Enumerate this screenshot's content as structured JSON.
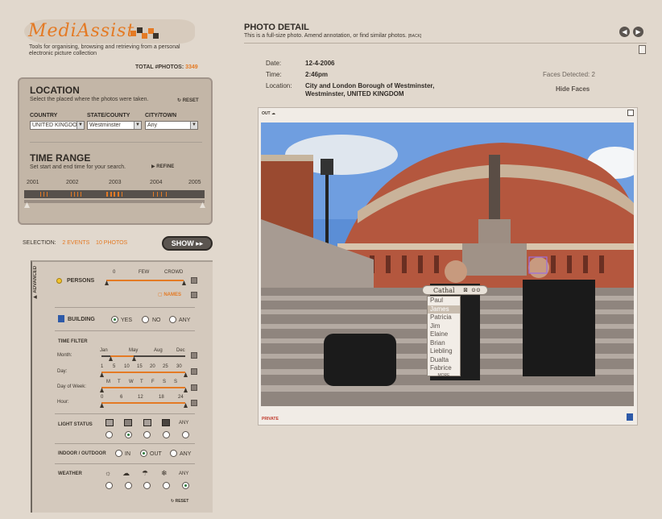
{
  "logo": {
    "text": "MediAssist",
    "tagline": "Tools for organising, browsing and retrieving from a personal electronic picture collection",
    "brand_color": "#e47a24"
  },
  "total": {
    "label": "TOTAL #PHOTOS:",
    "value": "3349"
  },
  "location": {
    "title": "LOCATION",
    "subtitle": "Select the placed where the photos were taken.",
    "reset_label": "RESET",
    "country_label": "COUNTRY",
    "country_value": "UNITED KINGDOM",
    "state_label": "STATE/COUNTY",
    "state_value": "Westminster",
    "city_label": "CITY/TOWN",
    "city_value": "Any"
  },
  "time_range": {
    "title": "TIME RANGE",
    "subtitle": "Set start and end time for your search.",
    "refine_label": "REFINE",
    "years": [
      "2001",
      "2002",
      "2003",
      "2004",
      "2005"
    ]
  },
  "selection": {
    "label": "SELECTION:",
    "events": "2 EVENTS",
    "photos": "10 PHOTOS",
    "show_label": "SHOW"
  },
  "advanced": {
    "tab_label": "ADVANCED",
    "persons_label": "PERSONS",
    "persons_scale": [
      "0",
      "FEW",
      "CROWD"
    ],
    "names_label": "NAMES",
    "building_label": "BUILDING",
    "building_options": [
      "YES",
      "NO",
      "ANY"
    ],
    "time_filter_label": "TIME FILTER",
    "month_label": "Month:",
    "month_scale": [
      "Jan",
      "May",
      "Aug",
      "Dec"
    ],
    "day_label": "Day:",
    "day_scale": [
      "1",
      "5",
      "10",
      "15",
      "20",
      "25",
      "30"
    ],
    "dow_label": "Day of Week:",
    "dow_scale": [
      "M",
      "T",
      "W",
      "T",
      "F",
      "S",
      "S"
    ],
    "hour_label": "Hour:",
    "hour_scale": [
      "0",
      "6",
      "12",
      "18",
      "24"
    ],
    "light_label": "LIGHT STATUS",
    "light_any": "ANY",
    "indoor_label": "INDOOR / OUTDOOR",
    "indoor_options": [
      "IN",
      "OUT",
      "ANY"
    ],
    "weather_label": "WEATHER",
    "weather_any": "ANY",
    "reset_label": "RESET"
  },
  "detail": {
    "title": "PHOTO DETAIL",
    "subtitle": "This is a full-size photo. Amend annotation, or find similar photos.",
    "back_label": "[BACK]",
    "date_label": "Date:",
    "date_value": "12-4-2006",
    "time_label": "Time:",
    "time_value": "2:46pm",
    "location_label": "Location:",
    "location_value_1": "City and London Borough of Westminster,",
    "location_value_2": "Westminster, UNITED KINGDOM",
    "faces_label": "Faces Detected: 2",
    "hide_faces_label": "Hide Faces",
    "out_label": "OUT",
    "private_label": "PRIVATE"
  },
  "names_popup": {
    "current": "Cathal",
    "items": [
      "Paul",
      "James",
      "Patricia",
      "Jim",
      "Elaine",
      "Brian",
      "Liebling",
      "Dualta",
      "Fabrice"
    ],
    "highlighted_index": 1,
    "more_label": "MORE"
  }
}
